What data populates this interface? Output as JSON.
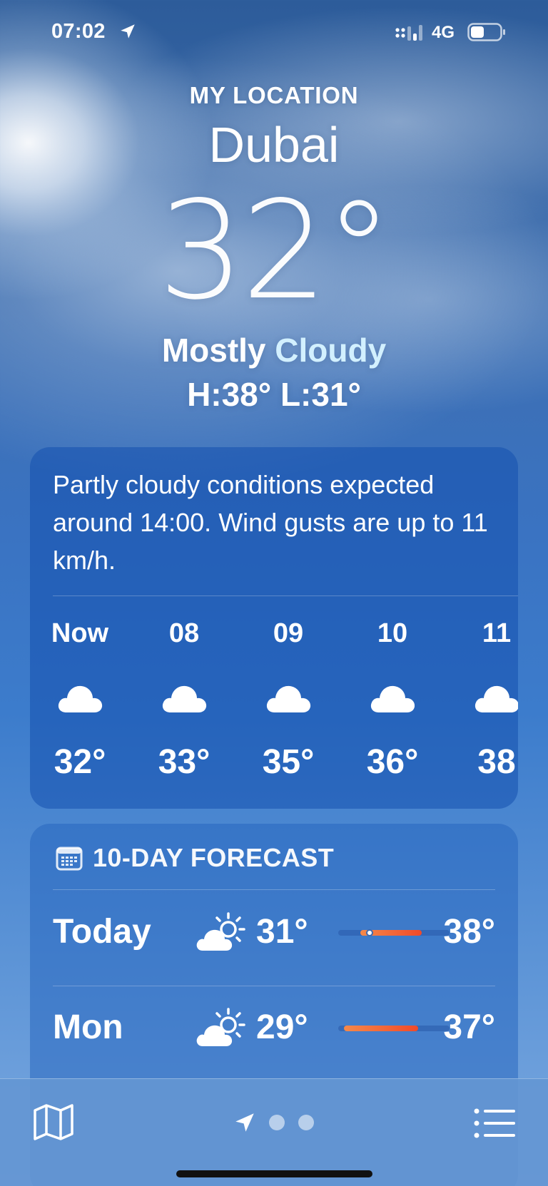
{
  "status_bar": {
    "time": "07:02",
    "network": "4G",
    "icons": [
      "location-arrow-icon",
      "signal-icon",
      "battery-icon"
    ]
  },
  "header": {
    "location_label": "MY LOCATION",
    "city": "Dubai",
    "temperature": "32°",
    "condition_part1": "Mostly",
    "condition_part2": "Cloudy",
    "hilo": "H:38°  L:31°"
  },
  "hourly": {
    "summary": "Partly cloudy conditions expected around 14:00. Wind gusts are up to 11 km/h.",
    "hours": [
      {
        "label": "Now",
        "icon": "cloud-icon",
        "temp": "32°"
      },
      {
        "label": "08",
        "icon": "cloud-icon",
        "temp": "33°"
      },
      {
        "label": "09",
        "icon": "cloud-icon",
        "temp": "35°"
      },
      {
        "label": "10",
        "icon": "cloud-icon",
        "temp": "36°"
      },
      {
        "label": "11",
        "icon": "cloud-icon",
        "temp": "38"
      }
    ]
  },
  "daily": {
    "title": "10-DAY FORECAST",
    "icon": "calendar-icon",
    "days": [
      {
        "name": "Today",
        "icon": "partly-cloudy-icon",
        "low": "31°",
        "high": "38°",
        "range_start": 0.2,
        "range_end": 0.75,
        "current": 0.28
      },
      {
        "name": "Mon",
        "icon": "partly-cloudy-icon",
        "low": "29°",
        "high": "37°",
        "range_start": 0.05,
        "range_end": 0.72
      }
    ]
  },
  "bottom_bar": {
    "icons": [
      "map-icon",
      "location-arrow-icon",
      "page-dot-icon",
      "list-icon"
    ]
  },
  "colors": {
    "sky_top": "#2d5c9a",
    "sky_bottom": "#7ba9e0",
    "card": "#1a50a8",
    "bar_start": "#f5894a",
    "bar_end": "#f04a2a",
    "condition_highlight": "#d2f0ff"
  }
}
